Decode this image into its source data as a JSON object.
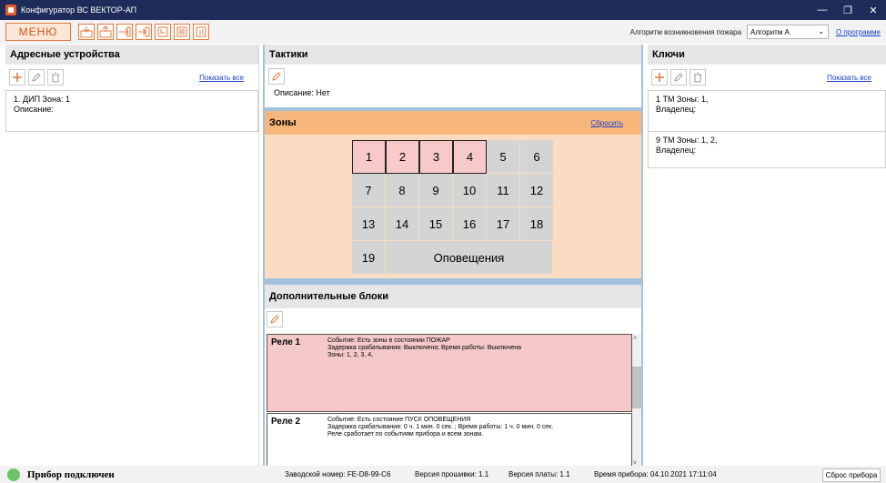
{
  "window": {
    "title": "Конфигуратор ВС ВЕКТОР-АП"
  },
  "toolbar": {
    "menu_label": "МЕНЮ",
    "algo_label": "Алгоритм возникновения пожара",
    "algo_value": "Алгоритм А",
    "about_label": "О программе",
    "icons": [
      "device-read-icon",
      "device-write-icon",
      "export-icon",
      "import-icon",
      "clock-icon",
      "log-icon",
      "info-icon"
    ]
  },
  "devices": {
    "title": "Адресные устройства",
    "show_all": "Показать все",
    "items": [
      {
        "line1": "1.  ДИП  Зона: 1",
        "line2": "Описание:"
      }
    ]
  },
  "tactics": {
    "title": "Тактики",
    "description": "Описание: Нет"
  },
  "zones": {
    "title": "Зоны",
    "reset_label": "Сбросить",
    "cells": [
      "1",
      "2",
      "3",
      "4",
      "5",
      "6",
      "7",
      "8",
      "9",
      "10",
      "11",
      "12",
      "13",
      "14",
      "15",
      "16",
      "17",
      "18",
      "19"
    ],
    "active": [
      "1",
      "2",
      "3",
      "4"
    ],
    "notify_label": "Оповещения"
  },
  "extra": {
    "title": "Дополнительные блоки",
    "relays": [
      {
        "name": "Реле 1",
        "line1": "Событие: Есть зоны в состоянии ПОЖАР",
        "line2": "Задержка срабатывания: Выключена; Время работы: Выключена",
        "line3": "Зоны: 1, 2, 3, 4,"
      },
      {
        "name": "Реле 2",
        "line1": "Событие: Есть состояние ПУСК ОПОВЕЩЕНИЯ",
        "line2": "Задержка срабатывания: 0 ч. 1 мин. 0 сек. ; Время работы: 1 ч. 0 мин. 0 сек.",
        "line3": "Реле сработает по событиям прибора и всем зонам."
      }
    ]
  },
  "keys": {
    "title": "Ключи",
    "show_all": "Показать все",
    "items": [
      {
        "line1": "1  ТМ Зоны: 1,",
        "line2": "Владелец:"
      },
      {
        "line1": "9  ТМ Зоны: 1, 2,",
        "line2": "Владелец:"
      }
    ]
  },
  "status": {
    "connection": "Прибор подключен",
    "serial": "Заводской номер: FE-D8-99-C6",
    "firmware": "Версия прошивки: 1.1",
    "board": "Версия платы: 1.1",
    "device_time": "Время прибора: 04.10.2021 17:11:04",
    "reset_device": "Сброс прибора"
  },
  "colors": {
    "accent": "#e47b3c",
    "zones_header": "#f7b77c",
    "zones_bg": "#f9dcc1",
    "relay_active": "#f6c9c9",
    "divider": "#a3c1dc"
  }
}
